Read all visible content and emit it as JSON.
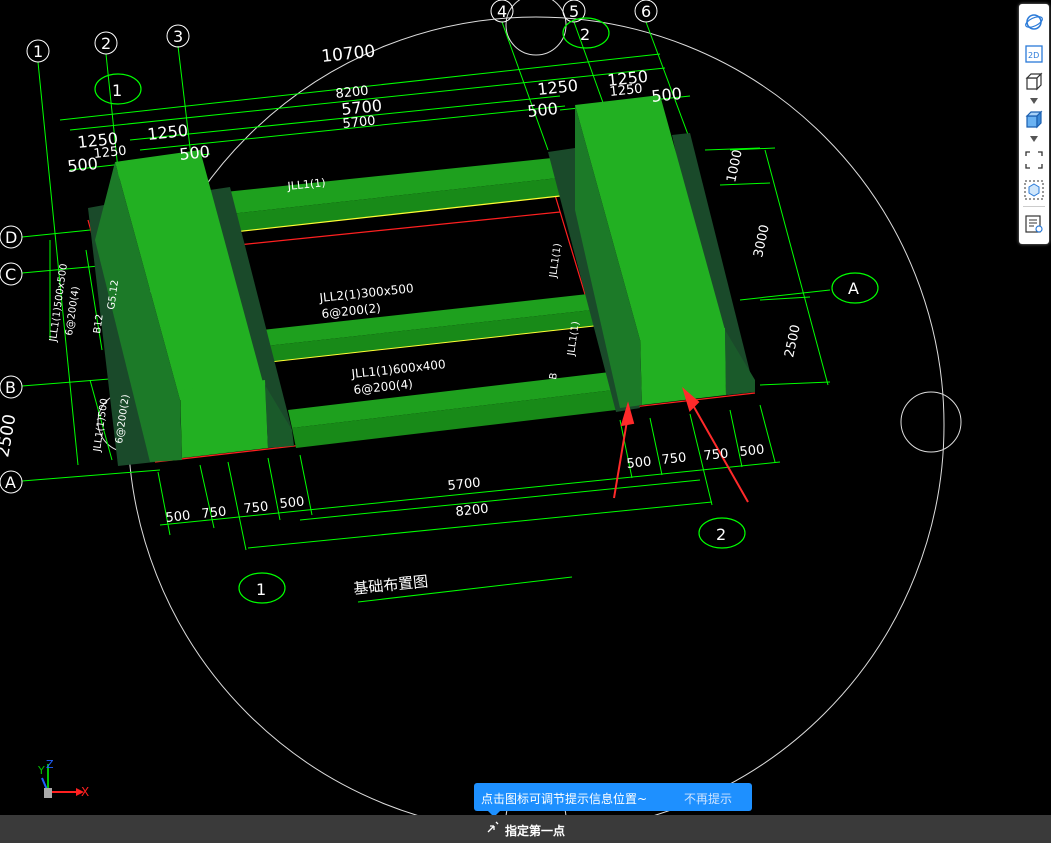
{
  "drawing": {
    "title": "基础布置图",
    "axes": {
      "top": [
        "1",
        "2",
        "3",
        "4",
        "5",
        "6"
      ],
      "left": [
        "D",
        "C",
        "B",
        "A"
      ],
      "callouts": [
        "1",
        "2",
        "1",
        "2",
        "A"
      ]
    },
    "dimensions": {
      "top_total": "10700",
      "top_mid": "8200",
      "top_inner_a": "5700",
      "top_inner_b": "5700",
      "top_left": [
        "1250",
        "1250",
        "1250",
        "500",
        "500",
        "500"
      ],
      "top_right": [
        "1250",
        "1250",
        "1250",
        "500",
        "500"
      ],
      "right": [
        "1000",
        "3000",
        "2500"
      ],
      "bottom_left": [
        "500",
        "750",
        "750",
        "500"
      ],
      "bottom_mid": [
        "5700",
        "8200"
      ],
      "bottom_right": [
        "500",
        "750",
        "750",
        "500"
      ],
      "left_side": "2500"
    },
    "annotations": {
      "beam_top": "JLL1(1)",
      "beam_mid_1": "JLL2(1)300x500",
      "beam_mid_2": "6@200(2)",
      "beam_low_1": "JLL1(1)600x400",
      "beam_low_2": "6@200(4)",
      "left_1": "JLL1(1)500x500",
      "left_2": "6@200(4)",
      "left_3": "B12",
      "left_4": "G5.12",
      "left_5": "JLL1(1)500",
      "left_6": "6@200(2)",
      "right_1": "JLL1(1)",
      "right_2": "JLL1(1)",
      "right_3": "B"
    }
  },
  "toolbar": {
    "items": [
      "orbit-icon",
      "view-2d-icon",
      "view-3d-icon",
      "view-3d-solid-icon",
      "fullscreen-icon",
      "zoom-3d-icon",
      "properties-icon"
    ],
    "label_2d": "2D"
  },
  "ucs": {
    "x": "X",
    "y": "Y",
    "z": "Z"
  },
  "tip": {
    "message": "点击图标可调节提示信息位置~",
    "dismiss": "不再提示"
  },
  "status": {
    "prompt": "指定第一点"
  },
  "colors": {
    "footing": "#22b022",
    "footing_side": "#1a4a2a",
    "beam": "#1ea01e",
    "dim_line": "#00ff00",
    "edge_red": "#ff2020",
    "beam_edge": "#ffff33",
    "tip_bg": "#1e90ff"
  }
}
